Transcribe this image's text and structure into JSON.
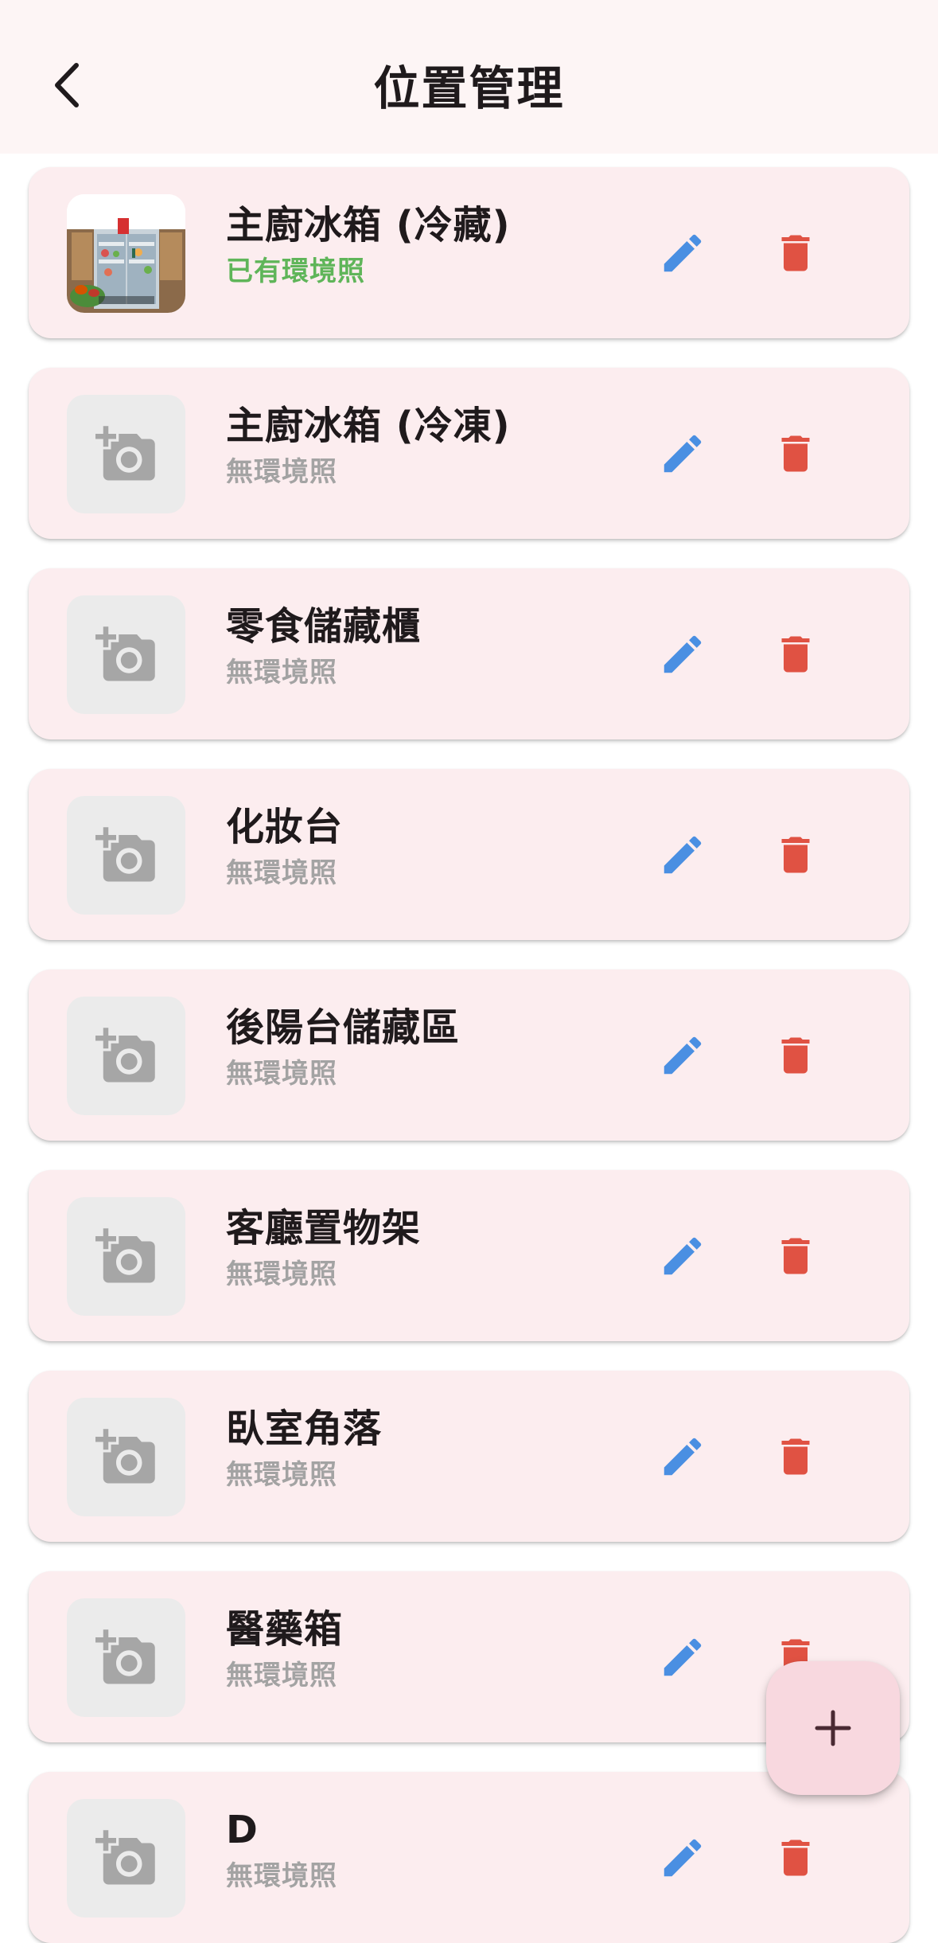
{
  "header": {
    "title": "位置管理",
    "back_icon": "arrow-back-icon"
  },
  "locations": [
    {
      "name": "主廚冰箱 (冷藏)",
      "status": "已有環境照",
      "has_photo": true
    },
    {
      "name": "主廚冰箱 (冷凍)",
      "status": "無環境照",
      "has_photo": false
    },
    {
      "name": "零食儲藏櫃",
      "status": "無環境照",
      "has_photo": false
    },
    {
      "name": "化妝台",
      "status": "無環境照",
      "has_photo": false
    },
    {
      "name": "後陽台儲藏區",
      "status": "無環境照",
      "has_photo": false
    },
    {
      "name": "客廳置物架",
      "status": "無環境照",
      "has_photo": false
    },
    {
      "name": "臥室角落",
      "status": "無環境照",
      "has_photo": false
    },
    {
      "name": "醫藥箱",
      "status": "無環境照",
      "has_photo": false
    },
    {
      "name": "D",
      "status": "無環境照",
      "has_photo": false
    }
  ],
  "icons": {
    "add_photo": "add-a-photo-icon",
    "edit": "edit-pencil-icon",
    "delete": "delete-trash-icon",
    "fab": "add-plus-icon"
  },
  "colors": {
    "app_bar_bg": "#fdf5f5",
    "card_bg": "#fcedef",
    "edit_icon": "#4a8fe2",
    "delete_icon": "#e05243",
    "has_photo_status": "#5fb559",
    "no_photo_status": "#a3a3a3",
    "fab_bg": "#f8d8df"
  }
}
